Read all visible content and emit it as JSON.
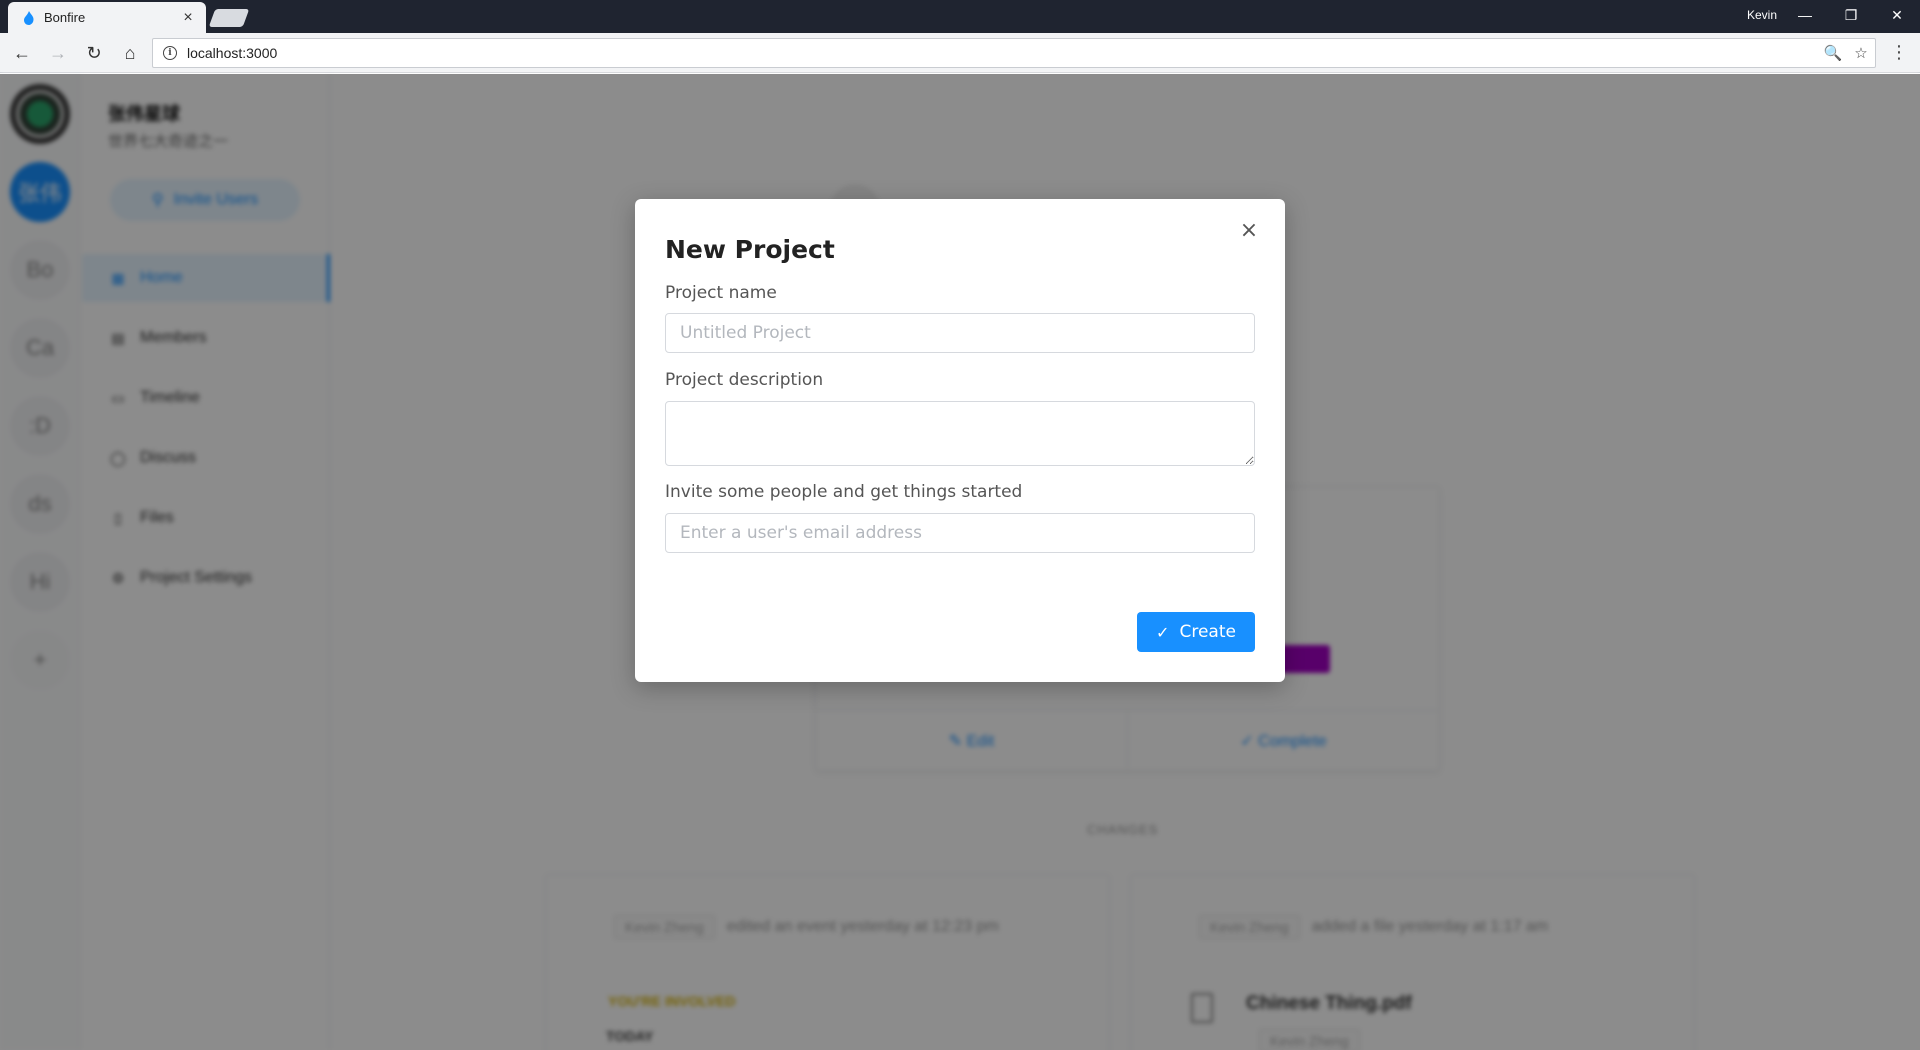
{
  "browser": {
    "tab_title": "Bonfire",
    "tab_close": "×",
    "user": "Kevin",
    "url": "localhost:3000",
    "controls": {
      "minimize": "—",
      "restore": "❐",
      "close": "✕"
    },
    "nav": {
      "back": "←",
      "forward": "→",
      "reload": "↻",
      "home": "⌂"
    },
    "zoom_icon": "🔍",
    "bookmark_icon": "☆",
    "menu_icon": "⋮"
  },
  "rail": {
    "items": [
      {
        "label": ""
      },
      {
        "label": "张伟"
      },
      {
        "label": "Bo"
      },
      {
        "label": "Ca"
      },
      {
        "label": ":D"
      },
      {
        "label": "ds"
      },
      {
        "label": "Hi"
      },
      {
        "label": "+"
      }
    ]
  },
  "sidebar": {
    "team_name": "张伟星球",
    "team_subtitle": "世界七大奇迹之一",
    "invite_label": "Invite Users",
    "items": [
      {
        "label": "Home",
        "icon": "▦"
      },
      {
        "label": "Members",
        "icon": "▤"
      },
      {
        "label": "Timeline",
        "icon": "▭"
      },
      {
        "label": "Discuss",
        "icon": "◯"
      },
      {
        "label": "Files",
        "icon": "▯"
      },
      {
        "label": "Project Settings",
        "icon": "⚙"
      }
    ]
  },
  "main": {
    "event_actions": {
      "edit": "✎ Edit",
      "complete": "✓ Complete"
    },
    "changes_title": "CHANGES",
    "changes": [
      {
        "user": "Kevin Zheng",
        "text": "edited an event yesterday at 12:23 pm",
        "badge": "YOU'RE INVOLVED",
        "when": "TODAY"
      },
      {
        "user": "Kevin Zheng",
        "text": "added a file yesterday at 1:17 am",
        "file": "Chinese Thing.pdf",
        "file_user": "Kevin Zheng"
      }
    ]
  },
  "modal": {
    "title": "New Project",
    "close": "×",
    "name_label": "Project name",
    "name_placeholder": "Untitled Project",
    "name_value": "",
    "description_label": "Project description",
    "description_value": "",
    "invite_label": "Invite some people and get things started",
    "invite_placeholder": "Enter a user's email address",
    "create_label": "Create",
    "create_icon": "✓"
  },
  "colors": {
    "accent": "#1890ff",
    "tag": "#a100c2",
    "involved": "#d4b106"
  }
}
